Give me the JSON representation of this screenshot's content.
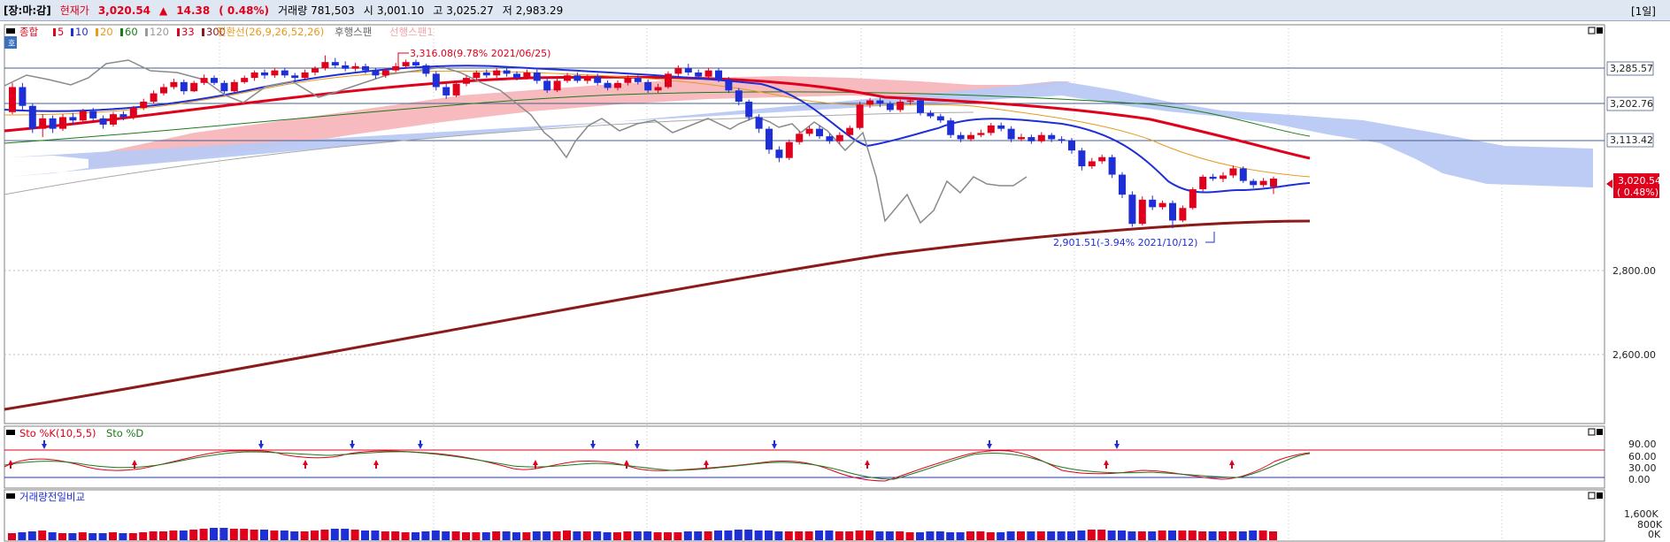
{
  "toolbar": {
    "market": "[장:마:감]",
    "price_label": "현재가",
    "price": "3,020.54",
    "change_arrow": "▲",
    "change": "14.38",
    "change_pct": "( 0.48%)",
    "volume_label": "거래량",
    "volume": "781,503",
    "open_label": "시",
    "open": "3,001.10",
    "high_label": "고",
    "high": "3,025.27",
    "low_label": "저",
    "low": "2,983.29",
    "period": "[1일]"
  },
  "main_panel": {
    "legend": {
      "index_name": "종합",
      "ma_items": [
        {
          "label": "5",
          "color": "#e0001b"
        },
        {
          "label": "10",
          "color": "#1e2fd6"
        },
        {
          "label": "20",
          "color": "#e69a1e"
        },
        {
          "label": "60",
          "color": "#1a7a1a"
        },
        {
          "label": "120",
          "color": "#9a9a9a"
        },
        {
          "label": "33",
          "color": "#e0001b"
        },
        {
          "label": "300",
          "color": "#8b1a1a"
        }
      ],
      "conversion_label": "전환선(26,9,26,52,26)",
      "lagging_label": "후행스팬",
      "leading_label": "선행스팬1"
    },
    "hlines": [
      "3,285.57",
      "3,202.76",
      "3,113.42"
    ],
    "y_ticks": [
      "2,800.00",
      "2,600.00"
    ],
    "current_price": "3,020.54",
    "current_pct": "( 0.48%)",
    "high_annotation": "3,316.08(9.78% 2021/06/25)",
    "low_annotation": "2,901.51(-3.94% 2021/10/12)"
  },
  "stochastic_panel": {
    "k_label": "Sto %K(10,5,5)",
    "d_label": "Sto %D",
    "y_ticks": [
      "90.00",
      "60.00",
      "30.00",
      "0.00"
    ]
  },
  "volume_panel": {
    "title": "거래량전일비교",
    "y_ticks": [
      "1,600K",
      "800K",
      "0K"
    ]
  },
  "chart_data": {
    "type": "candlestick",
    "title": "종합",
    "ylim": [
      2500,
      3380
    ],
    "yticks": [
      2600,
      2800
    ],
    "reference_lines": [
      3285.57,
      3202.76,
      3113.42
    ],
    "last_close": 3020.54,
    "annotations": [
      {
        "text": "3,316.08(9.78% 2021/06/25)",
        "value": 3316.08
      },
      {
        "text": "2,901.51(-3.94% 2021/10/12)",
        "value": 2901.51
      }
    ],
    "candles": [
      {
        "o": 3180,
        "c": 3240,
        "h": 3250,
        "l": 3175
      },
      {
        "o": 3240,
        "c": 3195,
        "h": 3250,
        "l": 3185
      },
      {
        "o": 3195,
        "c": 3140,
        "h": 3200,
        "l": 3130
      },
      {
        "o": 3140,
        "c": 3165,
        "h": 3175,
        "l": 3120
      },
      {
        "o": 3165,
        "c": 3140,
        "h": 3172,
        "l": 3130
      },
      {
        "o": 3140,
        "c": 3168,
        "h": 3175,
        "l": 3135
      },
      {
        "o": 3168,
        "c": 3160,
        "h": 3178,
        "l": 3150
      },
      {
        "o": 3160,
        "c": 3182,
        "h": 3188,
        "l": 3155
      },
      {
        "o": 3182,
        "c": 3165,
        "h": 3190,
        "l": 3160
      },
      {
        "o": 3165,
        "c": 3150,
        "h": 3172,
        "l": 3140
      },
      {
        "o": 3150,
        "c": 3175,
        "h": 3180,
        "l": 3145
      },
      {
        "o": 3175,
        "c": 3168,
        "h": 3182,
        "l": 3160
      },
      {
        "o": 3168,
        "c": 3190,
        "h": 3195,
        "l": 3162
      },
      {
        "o": 3190,
        "c": 3205,
        "h": 3212,
        "l": 3185
      },
      {
        "o": 3205,
        "c": 3225,
        "h": 3232,
        "l": 3200
      },
      {
        "o": 3225,
        "c": 3240,
        "h": 3248,
        "l": 3220
      },
      {
        "o": 3240,
        "c": 3252,
        "h": 3260,
        "l": 3235
      },
      {
        "o": 3252,
        "c": 3230,
        "h": 3258,
        "l": 3222
      },
      {
        "o": 3230,
        "c": 3250,
        "h": 3255,
        "l": 3228
      },
      {
        "o": 3250,
        "c": 3262,
        "h": 3270,
        "l": 3245
      },
      {
        "o": 3262,
        "c": 3250,
        "h": 3268,
        "l": 3245
      },
      {
        "o": 3250,
        "c": 3230,
        "h": 3256,
        "l": 3224
      },
      {
        "o": 3230,
        "c": 3252,
        "h": 3258,
        "l": 3226
      },
      {
        "o": 3252,
        "c": 3262,
        "h": 3268,
        "l": 3248
      },
      {
        "o": 3262,
        "c": 3275,
        "h": 3280,
        "l": 3255
      },
      {
        "o": 3275,
        "c": 3268,
        "h": 3282,
        "l": 3260
      },
      {
        "o": 3268,
        "c": 3280,
        "h": 3285,
        "l": 3262
      },
      {
        "o": 3280,
        "c": 3268,
        "h": 3286,
        "l": 3262
      },
      {
        "o": 3268,
        "c": 3262,
        "h": 3274,
        "l": 3255
      },
      {
        "o": 3262,
        "c": 3275,
        "h": 3282,
        "l": 3258
      },
      {
        "o": 3275,
        "c": 3285,
        "h": 3290,
        "l": 3268
      },
      {
        "o": 3285,
        "c": 3300,
        "h": 3316,
        "l": 3280
      },
      {
        "o": 3300,
        "c": 3292,
        "h": 3310,
        "l": 3285
      },
      {
        "o": 3292,
        "c": 3284,
        "h": 3302,
        "l": 3278
      },
      {
        "o": 3284,
        "c": 3290,
        "h": 3298,
        "l": 3278
      },
      {
        "o": 3290,
        "c": 3280,
        "h": 3296,
        "l": 3272
      },
      {
        "o": 3280,
        "c": 3268,
        "h": 3286,
        "l": 3260
      },
      {
        "o": 3268,
        "c": 3280,
        "h": 3285,
        "l": 3262
      },
      {
        "o": 3280,
        "c": 3290,
        "h": 3298,
        "l": 3276
      },
      {
        "o": 3290,
        "c": 3300,
        "h": 3306,
        "l": 3284
      },
      {
        "o": 3300,
        "c": 3292,
        "h": 3306,
        "l": 3286
      },
      {
        "o": 3292,
        "c": 3272,
        "h": 3296,
        "l": 3265
      },
      {
        "o": 3272,
        "c": 3240,
        "h": 3278,
        "l": 3232
      },
      {
        "o": 3240,
        "c": 3220,
        "h": 3248,
        "l": 3212
      },
      {
        "o": 3220,
        "c": 3248,
        "h": 3255,
        "l": 3216
      },
      {
        "o": 3248,
        "c": 3262,
        "h": 3268,
        "l": 3242
      },
      {
        "o": 3262,
        "c": 3275,
        "h": 3280,
        "l": 3256
      },
      {
        "o": 3275,
        "c": 3268,
        "h": 3282,
        "l": 3262
      },
      {
        "o": 3268,
        "c": 3280,
        "h": 3286,
        "l": 3262
      },
      {
        "o": 3280,
        "c": 3272,
        "h": 3285,
        "l": 3265
      },
      {
        "o": 3272,
        "c": 3262,
        "h": 3278,
        "l": 3256
      },
      {
        "o": 3262,
        "c": 3275,
        "h": 3282,
        "l": 3258
      },
      {
        "o": 3275,
        "c": 3255,
        "h": 3282,
        "l": 3248
      },
      {
        "o": 3255,
        "c": 3232,
        "h": 3262,
        "l": 3226
      },
      {
        "o": 3232,
        "c": 3255,
        "h": 3262,
        "l": 3228
      },
      {
        "o": 3255,
        "c": 3268,
        "h": 3274,
        "l": 3250
      },
      {
        "o": 3268,
        "c": 3255,
        "h": 3275,
        "l": 3250
      },
      {
        "o": 3255,
        "c": 3265,
        "h": 3270,
        "l": 3248
      },
      {
        "o": 3265,
        "c": 3250,
        "h": 3272,
        "l": 3244
      },
      {
        "o": 3250,
        "c": 3238,
        "h": 3256,
        "l": 3232
      },
      {
        "o": 3238,
        "c": 3250,
        "h": 3256,
        "l": 3232
      },
      {
        "o": 3250,
        "c": 3262,
        "h": 3268,
        "l": 3244
      },
      {
        "o": 3262,
        "c": 3252,
        "h": 3268,
        "l": 3246
      },
      {
        "o": 3252,
        "c": 3232,
        "h": 3258,
        "l": 3226
      },
      {
        "o": 3232,
        "c": 3240,
        "h": 3248,
        "l": 3226
      },
      {
        "o": 3240,
        "c": 3272,
        "h": 3278,
        "l": 3236
      },
      {
        "o": 3272,
        "c": 3285,
        "h": 3292,
        "l": 3266
      },
      {
        "o": 3285,
        "c": 3275,
        "h": 3296,
        "l": 3268
      },
      {
        "o": 3275,
        "c": 3265,
        "h": 3282,
        "l": 3258
      },
      {
        "o": 3265,
        "c": 3280,
        "h": 3286,
        "l": 3260
      },
      {
        "o": 3280,
        "c": 3258,
        "h": 3285,
        "l": 3252
      },
      {
        "o": 3258,
        "c": 3232,
        "h": 3264,
        "l": 3226
      },
      {
        "o": 3232,
        "c": 3205,
        "h": 3238,
        "l": 3196
      },
      {
        "o": 3205,
        "c": 3168,
        "h": 3210,
        "l": 3160
      },
      {
        "o": 3168,
        "c": 3140,
        "h": 3175,
        "l": 3130
      },
      {
        "o": 3140,
        "c": 3090,
        "h": 3146,
        "l": 3080
      },
      {
        "o": 3090,
        "c": 3070,
        "h": 3098,
        "l": 3060
      },
      {
        "o": 3070,
        "c": 3108,
        "h": 3114,
        "l": 3065
      },
      {
        "o": 3108,
        "c": 3128,
        "h": 3134,
        "l": 3102
      },
      {
        "o": 3128,
        "c": 3140,
        "h": 3146,
        "l": 3122
      },
      {
        "o": 3140,
        "c": 3122,
        "h": 3148,
        "l": 3116
      },
      {
        "o": 3122,
        "c": 3110,
        "h": 3128,
        "l": 3104
      },
      {
        "o": 3110,
        "c": 3125,
        "h": 3132,
        "l": 3104
      },
      {
        "o": 3125,
        "c": 3142,
        "h": 3148,
        "l": 3120
      },
      {
        "o": 3142,
        "c": 3198,
        "h": 3205,
        "l": 3138
      },
      {
        "o": 3198,
        "c": 3208,
        "h": 3214,
        "l": 3190
      },
      {
        "o": 3208,
        "c": 3200,
        "h": 3214,
        "l": 3192
      },
      {
        "o": 3200,
        "c": 3185,
        "h": 3206,
        "l": 3180
      },
      {
        "o": 3185,
        "c": 3205,
        "h": 3210,
        "l": 3180
      },
      {
        "o": 3205,
        "c": 3208,
        "h": 3214,
        "l": 3198
      },
      {
        "o": 3208,
        "c": 3178,
        "h": 3212,
        "l": 3172
      },
      {
        "o": 3178,
        "c": 3170,
        "h": 3184,
        "l": 3165
      },
      {
        "o": 3170,
        "c": 3160,
        "h": 3176,
        "l": 3154
      },
      {
        "o": 3160,
        "c": 3125,
        "h": 3166,
        "l": 3118
      },
      {
        "o": 3125,
        "c": 3115,
        "h": 3132,
        "l": 3108
      },
      {
        "o": 3115,
        "c": 3125,
        "h": 3132,
        "l": 3110
      },
      {
        "o": 3125,
        "c": 3130,
        "h": 3138,
        "l": 3120
      },
      {
        "o": 3130,
        "c": 3148,
        "h": 3154,
        "l": 3124
      },
      {
        "o": 3148,
        "c": 3140,
        "h": 3155,
        "l": 3134
      },
      {
        "o": 3140,
        "c": 3115,
        "h": 3146,
        "l": 3108
      },
      {
        "o": 3115,
        "c": 3120,
        "h": 3128,
        "l": 3110
      },
      {
        "o": 3120,
        "c": 3110,
        "h": 3126,
        "l": 3104
      },
      {
        "o": 3110,
        "c": 3125,
        "h": 3132,
        "l": 3106
      },
      {
        "o": 3125,
        "c": 3115,
        "h": 3130,
        "l": 3108
      },
      {
        "o": 3115,
        "c": 3112,
        "h": 3122,
        "l": 3105
      },
      {
        "o": 3112,
        "c": 3088,
        "h": 3118,
        "l": 3080
      },
      {
        "o": 3088,
        "c": 3050,
        "h": 3094,
        "l": 3040
      },
      {
        "o": 3050,
        "c": 3062,
        "h": 3070,
        "l": 3044
      },
      {
        "o": 3062,
        "c": 3072,
        "h": 3078,
        "l": 3056
      },
      {
        "o": 3072,
        "c": 3030,
        "h": 3078,
        "l": 3022
      },
      {
        "o": 3030,
        "c": 2982,
        "h": 3036,
        "l": 2974
      },
      {
        "o": 2982,
        "c": 2912,
        "h": 2990,
        "l": 2905
      },
      {
        "o": 2912,
        "c": 2970,
        "h": 2978,
        "l": 2908
      },
      {
        "o": 2970,
        "c": 2952,
        "h": 2980,
        "l": 2945
      },
      {
        "o": 2952,
        "c": 2962,
        "h": 2968,
        "l": 2946
      },
      {
        "o": 2962,
        "c": 2920,
        "h": 2968,
        "l": 2901.51
      },
      {
        "o": 2920,
        "c": 2950,
        "h": 2956,
        "l": 2916
      },
      {
        "o": 2950,
        "c": 2995,
        "h": 3000,
        "l": 2946
      },
      {
        "o": 2995,
        "c": 3025,
        "h": 3030,
        "l": 2990
      },
      {
        "o": 3025,
        "c": 3020,
        "h": 3032,
        "l": 3015
      },
      {
        "o": 3020,
        "c": 3028,
        "h": 3036,
        "l": 3012
      },
      {
        "o": 3028,
        "c": 3045,
        "h": 3052,
        "l": 3022
      },
      {
        "o": 3045,
        "c": 3015,
        "h": 3050,
        "l": 3010
      },
      {
        "o": 3015,
        "c": 3005,
        "h": 3020,
        "l": 2998
      },
      {
        "o": 3005,
        "c": 3015,
        "h": 3022,
        "l": 3000
      },
      {
        "o": 3001.1,
        "c": 3020.54,
        "h": 3025.27,
        "l": 2983.29
      }
    ]
  }
}
